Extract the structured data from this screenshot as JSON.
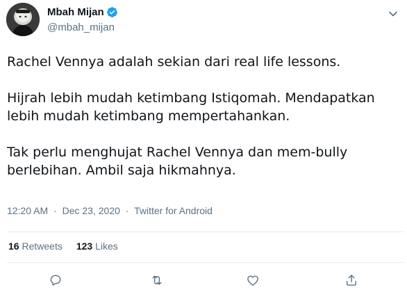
{
  "author": {
    "display_name": "Mbah Mijan",
    "handle": "@mbah_mijan",
    "verified": true,
    "avatar_icon": "avatar-photo",
    "verified_icon": "verified-badge-icon",
    "verified_color": "#1da1f2"
  },
  "tweet": {
    "paragraphs": [
      "Rachel Vennya adalah sekian dari real life lessons.",
      "Hijrah lebih mudah ketimbang Istiqomah. Mendapatkan lebih mudah ketimbang mempertahankan.",
      "Tak perlu menghujat Rachel Vennya dan mem-bully berlebihan. Ambil saja hikmahnya."
    ]
  },
  "meta": {
    "time": "12:20 AM",
    "separator": "·",
    "date": "Dec 23, 2020",
    "source": "Twitter for Android"
  },
  "stats": {
    "retweets_count": "16",
    "retweets_label": "Retweets",
    "likes_count": "123",
    "likes_label": "Likes"
  },
  "actions": [
    "reply-icon",
    "retweet-icon",
    "like-icon",
    "share-icon"
  ],
  "more_icon": "chevron-down-icon",
  "colors": {
    "text": "#0f1419",
    "secondary": "#5b7083",
    "divider": "#e6ecf0",
    "verified": "#1da1f2"
  }
}
